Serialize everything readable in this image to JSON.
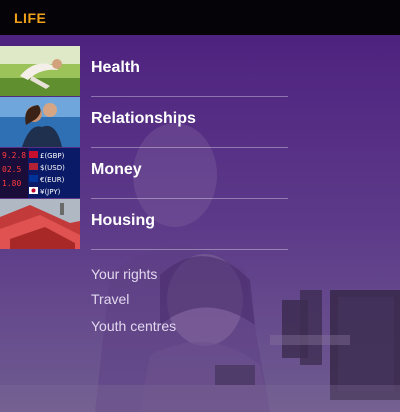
{
  "header": {
    "title": "LIFE"
  },
  "menu": {
    "items": [
      {
        "label": "Health",
        "thumb": "person-stretching-icon"
      },
      {
        "label": "Relationships",
        "thumb": "couple-icon"
      },
      {
        "label": "Money",
        "thumb": "currency-board-icon"
      },
      {
        "label": "Housing",
        "thumb": "rooftops-icon"
      }
    ]
  },
  "sub_links": [
    "Your rights",
    "Travel",
    "Youth centres"
  ],
  "colors": {
    "accent": "#f0a11a",
    "background": "#5a2f86",
    "top_bar": "#050308"
  }
}
